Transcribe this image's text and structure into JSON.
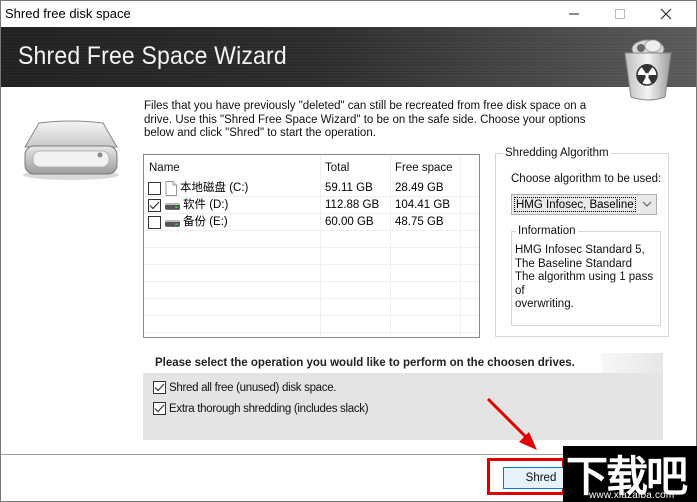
{
  "window": {
    "title": "Shred free disk space",
    "controls": {
      "minimize": "minimize",
      "maximize": "maximize",
      "close": "close"
    }
  },
  "banner": {
    "title": "Shred Free Space Wizard",
    "icon": "radioactive-bin-icon"
  },
  "intro": "Files that you have previously \"deleted\" can still be recreated from free disk space on a drive. Use this \"Shred Free Space Wizard\" to be on the safe side. Choose your options below and click \"Shred\" to start the operation.",
  "drives": {
    "columns": [
      "Name",
      "Total",
      "Free space"
    ],
    "rows": [
      {
        "name": "本地磁盘 (C:)",
        "total": "59.11 GB",
        "free": "28.49 GB",
        "checked": false,
        "icon": "file-drive-icon"
      },
      {
        "name": "软件 (D:)",
        "total": "112.88 GB",
        "free": "104.41 GB",
        "checked": true,
        "icon": "hard-drive-icon"
      },
      {
        "name": "备份 (E:)",
        "total": "60.00 GB",
        "free": "48.75 GB",
        "checked": false,
        "icon": "hard-drive-icon"
      }
    ]
  },
  "algorithm": {
    "group_label": "Shredding Algorithm",
    "choose_label": "Choose algorithm to be used:",
    "selected": "HMG Infosec, Baseline",
    "info_label": "Information",
    "info_lines": [
      "HMG Infosec Standard 5,",
      "The Baseline Standard",
      "The algorithm using 1 pass of",
      "overwriting."
    ]
  },
  "operations": {
    "title": "Please select the operation you would like to perform on the choosen drives.",
    "options": [
      {
        "label": "Shred all free (unused) disk space.",
        "checked": true
      },
      {
        "label": "Extra thorough shredding (includes slack)",
        "checked": true
      }
    ]
  },
  "buttons": {
    "shred": "Shred"
  },
  "annotation": {
    "highlight_color": "#e00000"
  },
  "watermark": {
    "text": "下载吧",
    "url": "www.xiazaiba.com"
  }
}
